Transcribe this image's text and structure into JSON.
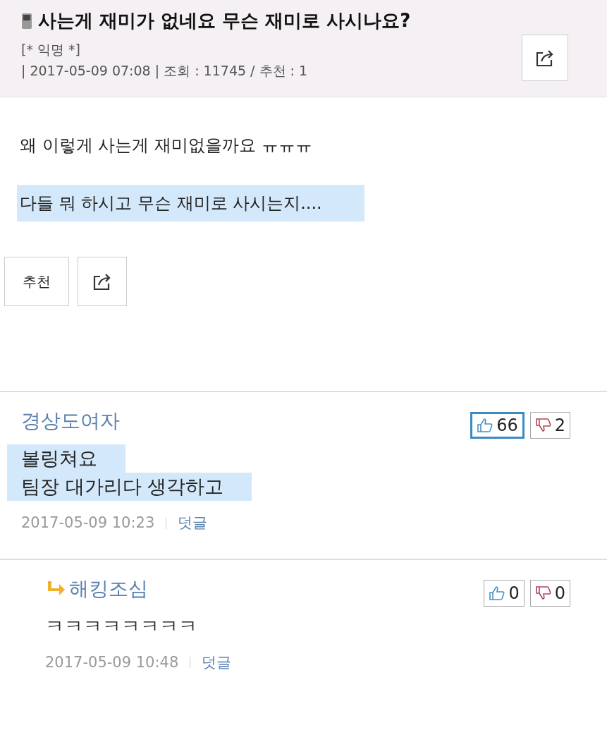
{
  "post": {
    "title": "사는게 재미가 없네요 무슨 재미로 사시나요?",
    "author": "[* 익명 *]",
    "meta": "| 2017-05-09 07:08 | 조회 : 11745 / 추천 : 1",
    "lines": [
      {
        "text": "왜 이렇게 사는게 재미없을까요 ㅠㅠㅠ",
        "highlighted": false
      },
      {
        "text": "다들 뭐 하시고 무슨 재미로 사시는지....",
        "highlighted": true
      }
    ],
    "recommend_label": "추천"
  },
  "comments": [
    {
      "author": "경상도여자",
      "reply": false,
      "up": {
        "count": "66",
        "selected": true
      },
      "down": {
        "count": "2",
        "selected": false
      },
      "lines": [
        {
          "text": "볼링쳐요",
          "highlighted": true
        },
        {
          "text": "팀장 대가리다 생각하고",
          "highlighted": true
        }
      ],
      "date": "2017-05-09 10:23",
      "reply_link": "덧글"
    },
    {
      "author": "해킹조심",
      "reply": true,
      "up": {
        "count": "0",
        "selected": false
      },
      "down": {
        "count": "0",
        "selected": false
      },
      "lines": [
        {
          "text": "ㅋㅋㅋㅋㅋㅋㅋㅋ",
          "highlighted": false
        }
      ],
      "date": "2017-05-09 10:48",
      "reply_link": "덧글"
    }
  ]
}
